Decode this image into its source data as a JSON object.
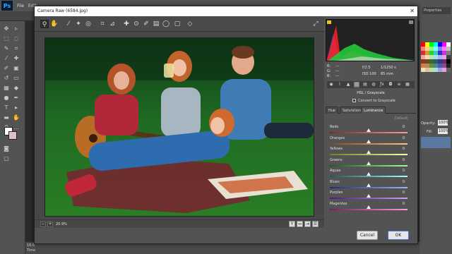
{
  "photoshop": {
    "logo": "Ps",
    "menu": [
      "File",
      "Edit"
    ],
    "doc_tab_fragment": "6584",
    "status_fragment": "16.6",
    "status_fragment2": "Time",
    "right_tab_fragment": "Properties",
    "opacity_label": "Opacity:",
    "opacity_value": "100%",
    "fill_label": "Fill:",
    "fill_value": "100%",
    "props_fragment": "Lib"
  },
  "dialog": {
    "title": "Camera Raw (6584.jpg)",
    "close_glyph": "✕",
    "zoom_value": "20.9%",
    "zoom_minus": "−",
    "zoom_plus": "+",
    "cancel_label": "Cancel",
    "ok_label": "OK"
  },
  "info": {
    "r_label": "R:",
    "g_label": "G:",
    "b_label": "B:",
    "r_value": "---",
    "g_value": "---",
    "b_value": "---",
    "aperture": "f/2.5",
    "shutter": "1/1250 s",
    "iso": "ISO 100",
    "focal": "85 mm"
  },
  "panel": {
    "title": "HSL / Grayscale",
    "convert_label": "Convert to Grayscale",
    "tabs": [
      "Hue",
      "Saturation",
      "Luminance"
    ],
    "active_tab": "Luminance",
    "default_label": "Default",
    "sliders": [
      {
        "name": "Reds",
        "value": "0",
        "colors": [
          "#7a2a2a",
          "#ff9a9a"
        ]
      },
      {
        "name": "Oranges",
        "value": "0",
        "colors": [
          "#7a4a1e",
          "#ffc27a"
        ]
      },
      {
        "name": "Yellows",
        "value": "0",
        "colors": [
          "#7a7a1e",
          "#ffff9a"
        ]
      },
      {
        "name": "Greens",
        "value": "0",
        "colors": [
          "#1e5a1e",
          "#9aff9a"
        ]
      },
      {
        "name": "Aquas",
        "value": "0",
        "colors": [
          "#1e5a5a",
          "#9affff"
        ]
      },
      {
        "name": "Blues",
        "value": "0",
        "colors": [
          "#1e2a7a",
          "#9ab4ff"
        ]
      },
      {
        "name": "Purples",
        "value": "0",
        "colors": [
          "#4a1e7a",
          "#d29aff"
        ]
      },
      {
        "name": "Magentas",
        "value": "0",
        "colors": [
          "#7a1e5a",
          "#ff9ae6"
        ]
      }
    ]
  },
  "colors": {
    "accent": "#3d7bd8",
    "dialog_bg": "#535353"
  }
}
